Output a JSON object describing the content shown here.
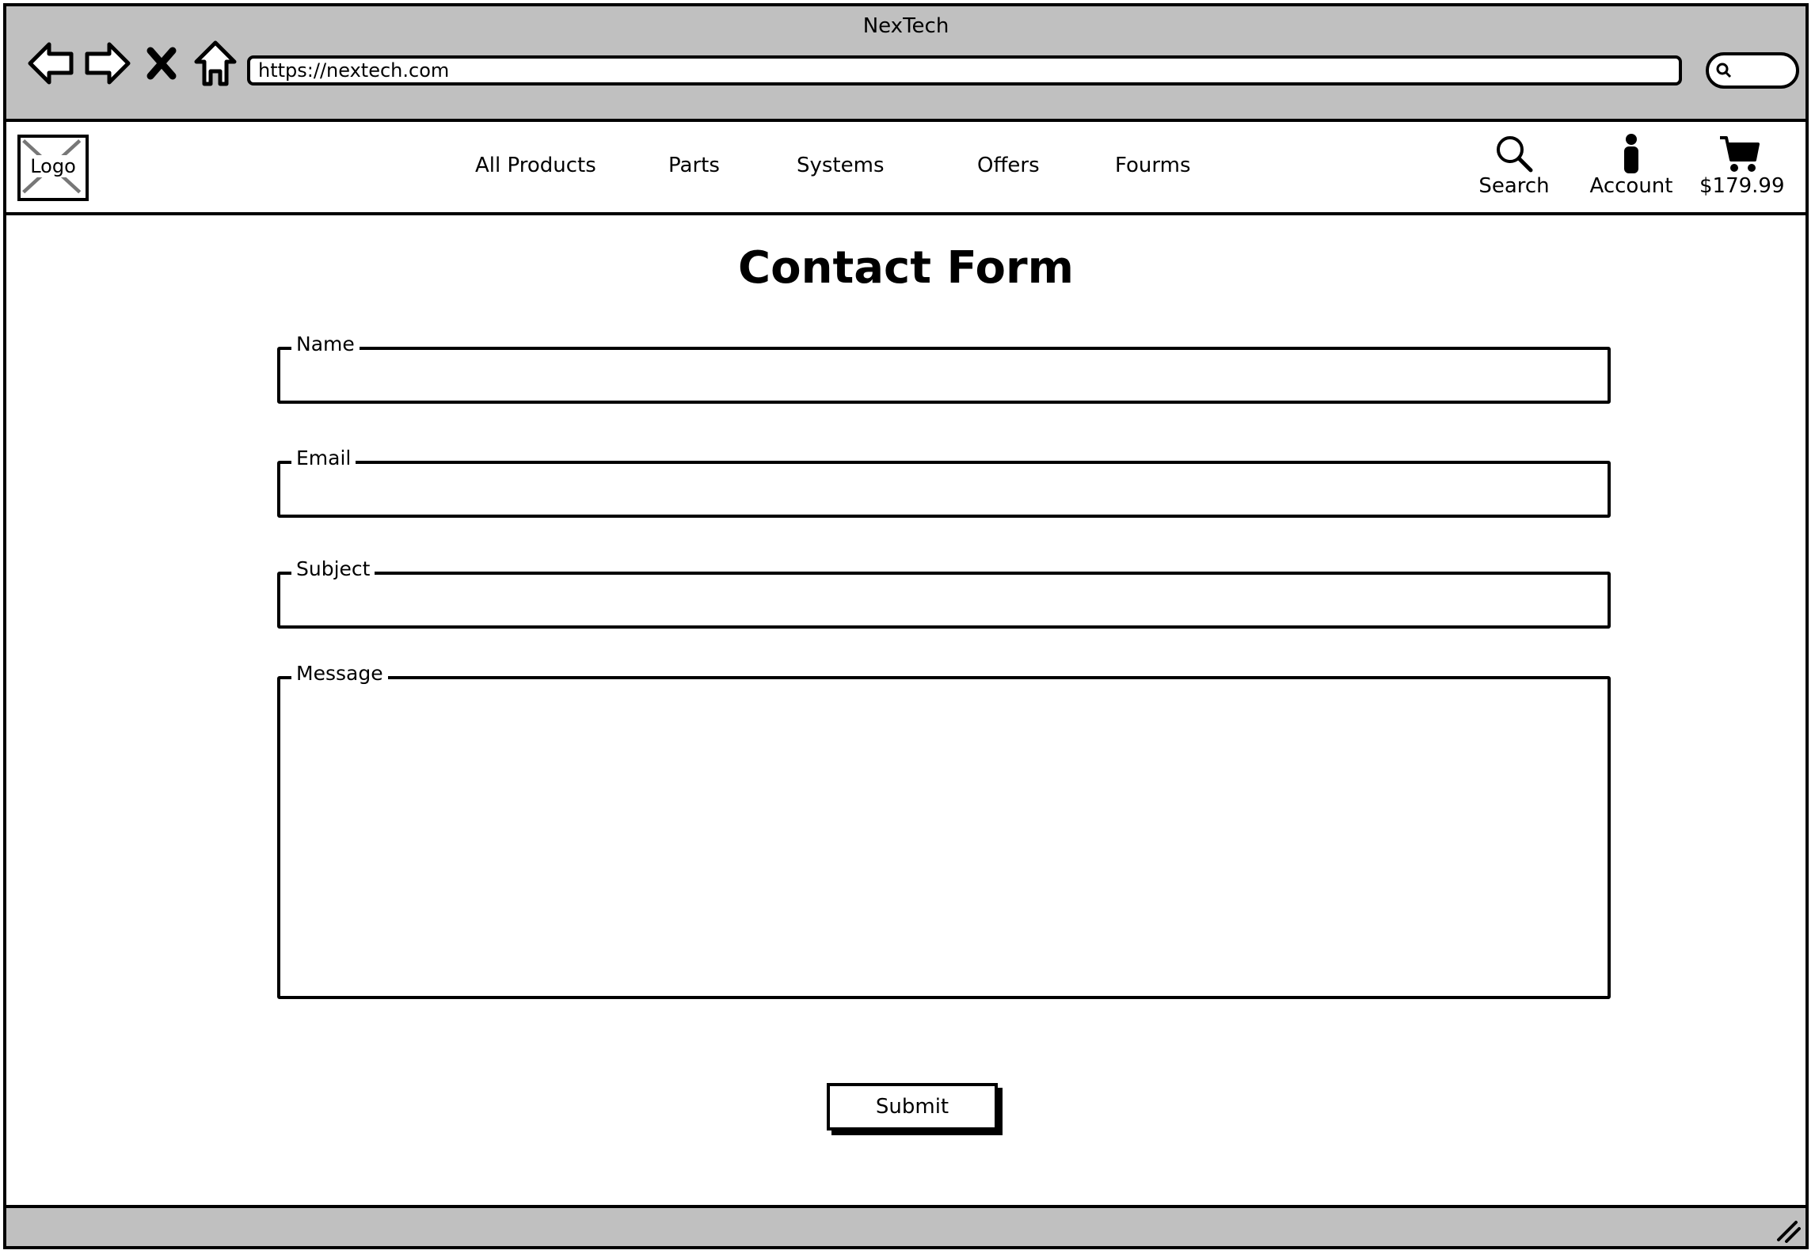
{
  "browser": {
    "title": "NexTech",
    "url": "https://nextech.com",
    "icons": [
      "back-arrow-icon",
      "forward-arrow-icon",
      "close-icon",
      "home-icon",
      "search-icon"
    ]
  },
  "header": {
    "logo_label": "Logo",
    "nav": [
      "All Products",
      "Parts",
      "Systems",
      "Offers",
      "Fourms"
    ],
    "search_label": "Search",
    "account_label": "Account",
    "cart_total": "$179.99"
  },
  "form": {
    "title": "Contact Form",
    "name_label": "Name",
    "email_label": "Email",
    "subject_label": "Subject",
    "message_label": "Message",
    "name_value": "",
    "email_value": "",
    "subject_value": "",
    "message_value": "",
    "submit_label": "Submit"
  }
}
